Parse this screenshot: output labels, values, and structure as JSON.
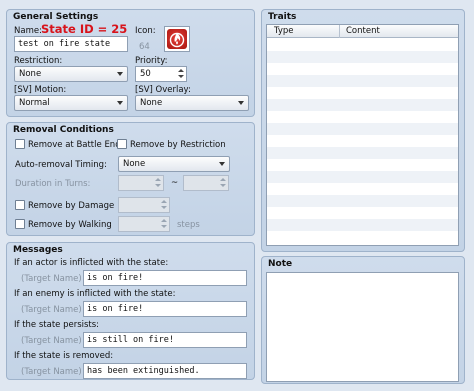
{
  "general": {
    "title": "General Settings",
    "name_label": "Name:",
    "state_id": "State ID = 25",
    "icon_label": "Icon:",
    "name_value": "test on fire state",
    "icon_index": "64",
    "restriction_label": "Restriction:",
    "restriction_value": "None",
    "priority_label": "Priority:",
    "priority_value": "50",
    "motion_label": "[SV] Motion:",
    "motion_value": "Normal",
    "overlay_label": "[SV] Overlay:",
    "overlay_value": "None"
  },
  "removal": {
    "title": "Removal Conditions",
    "battle_end": "Remove at Battle End",
    "by_restriction": "Remove by Restriction",
    "auto_timing_label": "Auto-removal Timing:",
    "auto_timing_value": "None",
    "duration_label": "Duration in Turns:",
    "tilde": "~",
    "by_damage": "Remove by Damage",
    "by_walking": "Remove by Walking",
    "steps": "steps"
  },
  "messages": {
    "title": "Messages",
    "actor_label": "If an actor is inflicted with the state:",
    "enemy_label": "If an enemy is inflicted with the state:",
    "persists_label": "If the state persists:",
    "removed_label": "If the state is removed:",
    "target_placeholder": "(Target Name)",
    "actor_msg": "is on fire!",
    "enemy_msg": "is on fire!",
    "persists_msg": "is still on fire!",
    "removed_msg": "has been extinguished."
  },
  "traits": {
    "title": "Traits",
    "col_type": "Type",
    "col_content": "Content"
  },
  "note": {
    "title": "Note"
  },
  "colors": {
    "state_id": "#d8131b",
    "icon": "#c8201a"
  },
  "icons": {
    "state_icon": "fire-icon"
  }
}
